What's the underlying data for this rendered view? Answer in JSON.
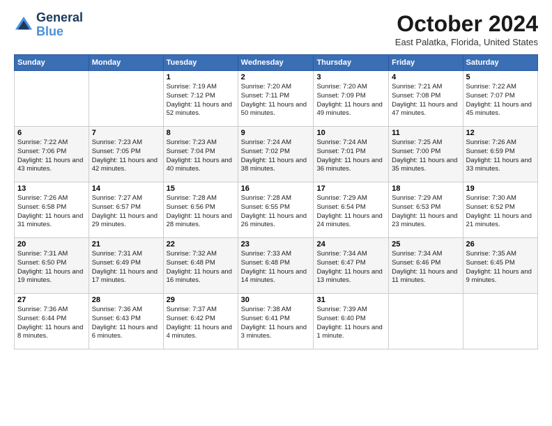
{
  "logo": {
    "line1": "General",
    "line2": "Blue"
  },
  "title": "October 2024",
  "location": "East Palatka, Florida, United States",
  "weekdays": [
    "Sunday",
    "Monday",
    "Tuesday",
    "Wednesday",
    "Thursday",
    "Friday",
    "Saturday"
  ],
  "weeks": [
    [
      {
        "day": "",
        "info": ""
      },
      {
        "day": "",
        "info": ""
      },
      {
        "day": "1",
        "info": "Sunrise: 7:19 AM\nSunset: 7:12 PM\nDaylight: 11 hours and 52 minutes."
      },
      {
        "day": "2",
        "info": "Sunrise: 7:20 AM\nSunset: 7:11 PM\nDaylight: 11 hours and 50 minutes."
      },
      {
        "day": "3",
        "info": "Sunrise: 7:20 AM\nSunset: 7:09 PM\nDaylight: 11 hours and 49 minutes."
      },
      {
        "day": "4",
        "info": "Sunrise: 7:21 AM\nSunset: 7:08 PM\nDaylight: 11 hours and 47 minutes."
      },
      {
        "day": "5",
        "info": "Sunrise: 7:22 AM\nSunset: 7:07 PM\nDaylight: 11 hours and 45 minutes."
      }
    ],
    [
      {
        "day": "6",
        "info": "Sunrise: 7:22 AM\nSunset: 7:06 PM\nDaylight: 11 hours and 43 minutes."
      },
      {
        "day": "7",
        "info": "Sunrise: 7:23 AM\nSunset: 7:05 PM\nDaylight: 11 hours and 42 minutes."
      },
      {
        "day": "8",
        "info": "Sunrise: 7:23 AM\nSunset: 7:04 PM\nDaylight: 11 hours and 40 minutes."
      },
      {
        "day": "9",
        "info": "Sunrise: 7:24 AM\nSunset: 7:02 PM\nDaylight: 11 hours and 38 minutes."
      },
      {
        "day": "10",
        "info": "Sunrise: 7:24 AM\nSunset: 7:01 PM\nDaylight: 11 hours and 36 minutes."
      },
      {
        "day": "11",
        "info": "Sunrise: 7:25 AM\nSunset: 7:00 PM\nDaylight: 11 hours and 35 minutes."
      },
      {
        "day": "12",
        "info": "Sunrise: 7:26 AM\nSunset: 6:59 PM\nDaylight: 11 hours and 33 minutes."
      }
    ],
    [
      {
        "day": "13",
        "info": "Sunrise: 7:26 AM\nSunset: 6:58 PM\nDaylight: 11 hours and 31 minutes."
      },
      {
        "day": "14",
        "info": "Sunrise: 7:27 AM\nSunset: 6:57 PM\nDaylight: 11 hours and 29 minutes."
      },
      {
        "day": "15",
        "info": "Sunrise: 7:28 AM\nSunset: 6:56 PM\nDaylight: 11 hours and 28 minutes."
      },
      {
        "day": "16",
        "info": "Sunrise: 7:28 AM\nSunset: 6:55 PM\nDaylight: 11 hours and 26 minutes."
      },
      {
        "day": "17",
        "info": "Sunrise: 7:29 AM\nSunset: 6:54 PM\nDaylight: 11 hours and 24 minutes."
      },
      {
        "day": "18",
        "info": "Sunrise: 7:29 AM\nSunset: 6:53 PM\nDaylight: 11 hours and 23 minutes."
      },
      {
        "day": "19",
        "info": "Sunrise: 7:30 AM\nSunset: 6:52 PM\nDaylight: 11 hours and 21 minutes."
      }
    ],
    [
      {
        "day": "20",
        "info": "Sunrise: 7:31 AM\nSunset: 6:50 PM\nDaylight: 11 hours and 19 minutes."
      },
      {
        "day": "21",
        "info": "Sunrise: 7:31 AM\nSunset: 6:49 PM\nDaylight: 11 hours and 17 minutes."
      },
      {
        "day": "22",
        "info": "Sunrise: 7:32 AM\nSunset: 6:48 PM\nDaylight: 11 hours and 16 minutes."
      },
      {
        "day": "23",
        "info": "Sunrise: 7:33 AM\nSunset: 6:48 PM\nDaylight: 11 hours and 14 minutes."
      },
      {
        "day": "24",
        "info": "Sunrise: 7:34 AM\nSunset: 6:47 PM\nDaylight: 11 hours and 13 minutes."
      },
      {
        "day": "25",
        "info": "Sunrise: 7:34 AM\nSunset: 6:46 PM\nDaylight: 11 hours and 11 minutes."
      },
      {
        "day": "26",
        "info": "Sunrise: 7:35 AM\nSunset: 6:45 PM\nDaylight: 11 hours and 9 minutes."
      }
    ],
    [
      {
        "day": "27",
        "info": "Sunrise: 7:36 AM\nSunset: 6:44 PM\nDaylight: 11 hours and 8 minutes."
      },
      {
        "day": "28",
        "info": "Sunrise: 7:36 AM\nSunset: 6:43 PM\nDaylight: 11 hours and 6 minutes."
      },
      {
        "day": "29",
        "info": "Sunrise: 7:37 AM\nSunset: 6:42 PM\nDaylight: 11 hours and 4 minutes."
      },
      {
        "day": "30",
        "info": "Sunrise: 7:38 AM\nSunset: 6:41 PM\nDaylight: 11 hours and 3 minutes."
      },
      {
        "day": "31",
        "info": "Sunrise: 7:39 AM\nSunset: 6:40 PM\nDaylight: 11 hours and 1 minute."
      },
      {
        "day": "",
        "info": ""
      },
      {
        "day": "",
        "info": ""
      }
    ]
  ]
}
